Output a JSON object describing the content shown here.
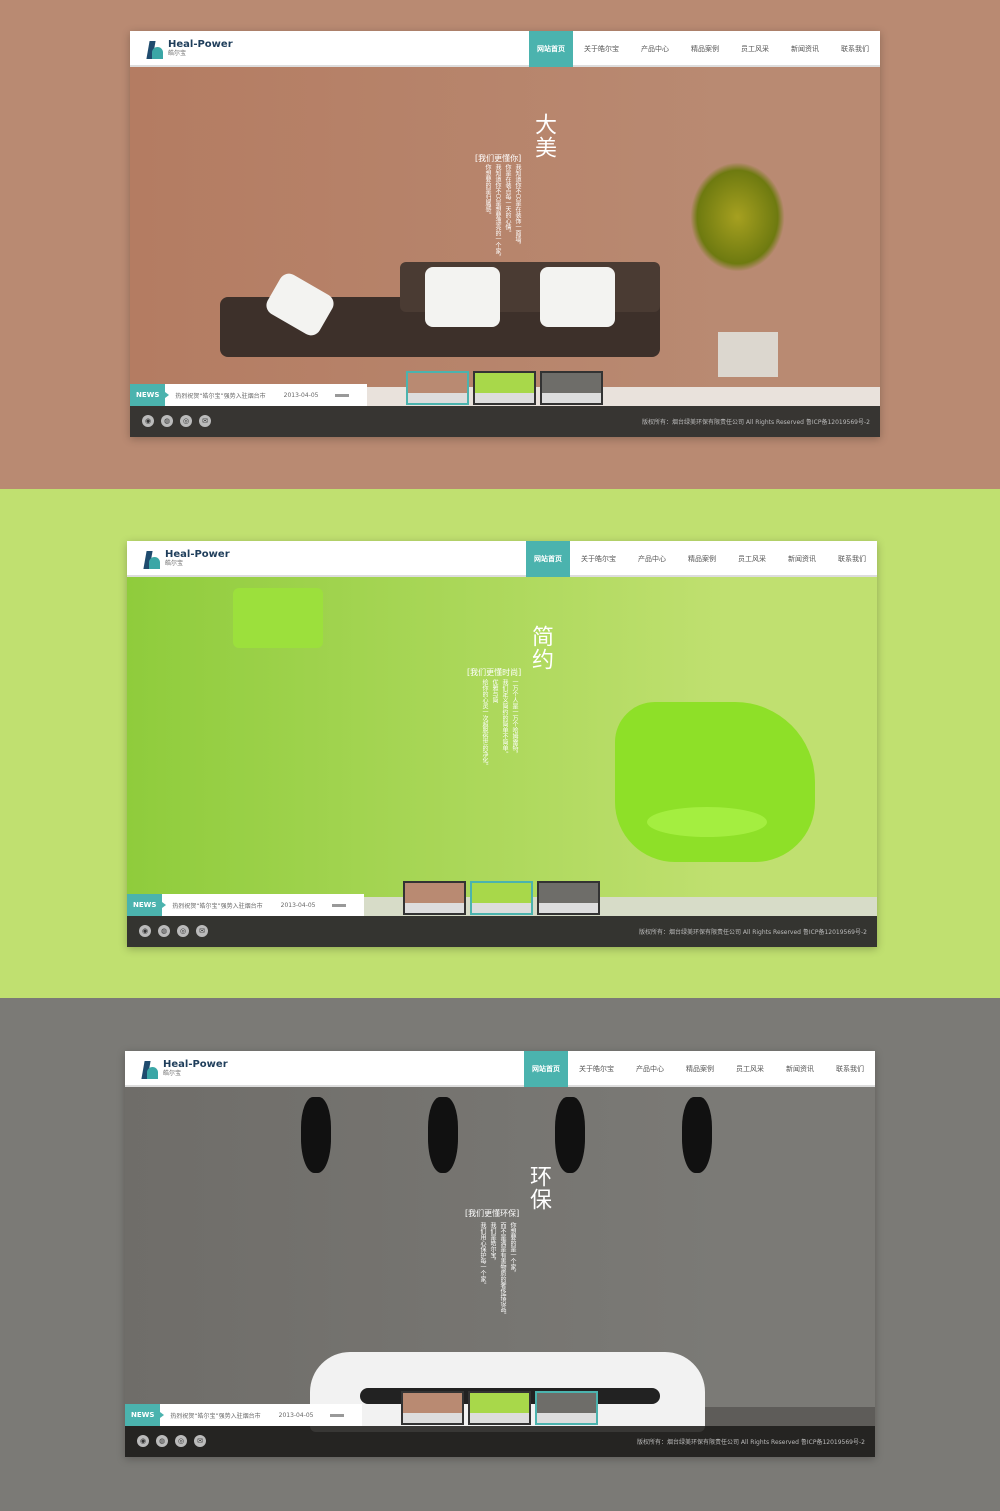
{
  "brand": {
    "name_en": "Heal-Power",
    "name_cn": "皓尔宝"
  },
  "nav": [
    "网站首页",
    "关于皓尔宝",
    "产品中心",
    "精品案例",
    "员工风采",
    "新闻资讯",
    "联系我们"
  ],
  "news": {
    "badge": "NEWS",
    "headline": "热烈祝贺“皓尔宝”强势入驻烟台市",
    "date": "2013-04-05"
  },
  "footer": {
    "copyright": "版权所有：烟台绿美环保有限责任公司 All Rights Reserved  鲁ICP备12019569号-2",
    "icons": [
      "qq-icon",
      "wechat-icon",
      "weibo-icon",
      "mail-icon"
    ]
  },
  "panels": [
    {
      "bg": "#b98a72",
      "wall": "#b47c62",
      "floor": "#e9e2dc",
      "title": "大美",
      "tag": "[我们更懂你]",
      "active_thumb": 0,
      "lines": [
        "我知道你不只是在装饰一面墙，",
        "你是在装点每一天的心情。",
        "我知道你不只是想要漂亮的一个家，",
        "你想要的是归属感。"
      ]
    },
    {
      "bg": "#c0e070",
      "wall": "#8fcc3c",
      "floor": "#d7dcc8",
      "title": "简约",
      "tag": "[我们更懂时尚]",
      "active_thumb": 1,
      "lines": [
        "一万个人是一万个哈姆雷特，",
        "我们定义简约的简单不简单。",
        "优雅与简",
        "给你的心灵一次超脱俗世的净化。"
      ]
    },
    {
      "bg": "#7b7a76",
      "wall": "#6f6d69",
      "floor": "#5e5c59",
      "title": "环保",
      "tag": "[我们更懂环保]",
      "active_thumb": 2,
      "lines": [
        "你想要的是一个家，",
        "而不是满是有害物质的奢侈摆设品。",
        "我们是皓尔宝，",
        "我们用心保护每一个家。"
      ]
    }
  ]
}
